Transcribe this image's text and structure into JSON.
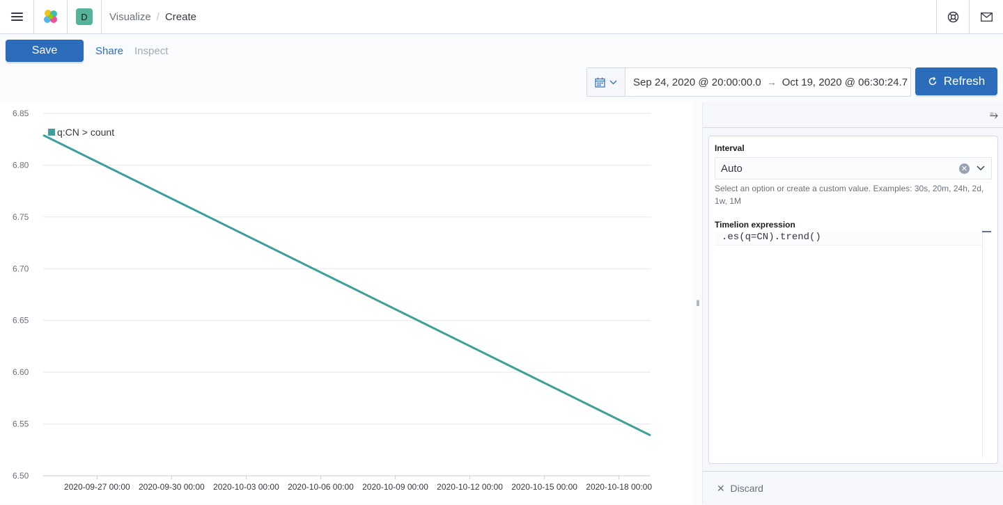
{
  "header": {
    "menu_icon": "hamburger-icon",
    "logo_icon": "elastic-logo-icon",
    "space_initial": "D",
    "breadcrumb_parent": "Visualize",
    "breadcrumb_separator": "/",
    "breadcrumb_current": "Create",
    "help_icon": "help-icon",
    "mail_icon": "mail-icon"
  },
  "toolbar": {
    "save_label": "Save",
    "share_label": "Share",
    "inspect_label": "Inspect",
    "date_start": "Sep 24, 2020 @ 20:00:00.0",
    "date_arrow": "→",
    "date_end": "Oct 19, 2020 @ 06:30:24.7",
    "refresh_label": "Refresh"
  },
  "sidebar": {
    "interval_label": "Interval",
    "interval_value": "Auto",
    "interval_help": "Select an option or create a custom value. Examples: 30s, 20m, 24h, 2d, 1w, 1M",
    "expression_label": "Timelion expression",
    "expression_value": ".es(q=CN).trend()",
    "discard_label": "Discard"
  },
  "chart_data": {
    "type": "line",
    "legend": [
      "q:CN > count"
    ],
    "ylim": [
      6.5,
      6.85
    ],
    "y_ticks": [
      "6.85",
      "6.80",
      "6.75",
      "6.70",
      "6.65",
      "6.60",
      "6.55",
      "6.50"
    ],
    "x_ticks": [
      "2020-09-27 00:00",
      "2020-09-30 00:00",
      "2020-10-03 00:00",
      "2020-10-06 00:00",
      "2020-10-09 00:00",
      "2020-10-12 00:00",
      "2020-10-15 00:00",
      "2020-10-18 00:00"
    ],
    "series": [
      {
        "name": "q:CN > count",
        "color": "#3e9e9a",
        "x": [
          "2020-09-24 20:00",
          "2020-10-19 06:30"
        ],
        "y": [
          6.829,
          6.539
        ]
      }
    ],
    "grid": true,
    "legend_position": "top-left"
  }
}
